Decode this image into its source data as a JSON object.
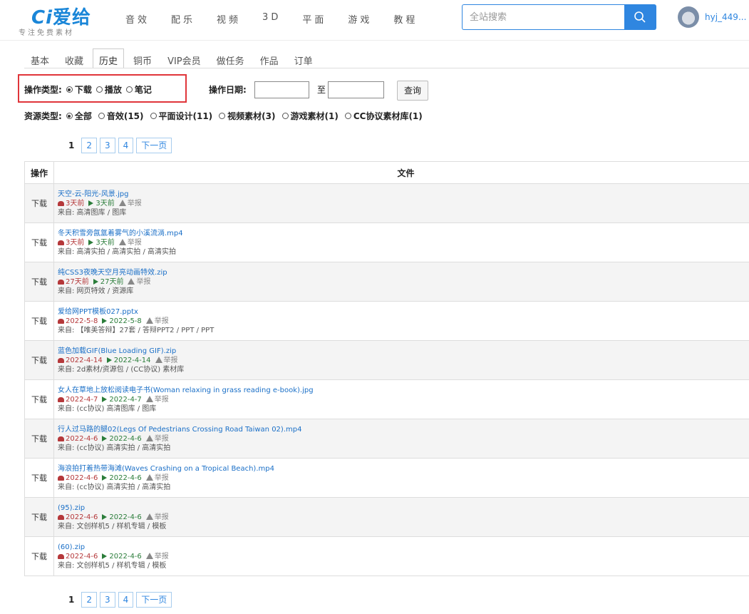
{
  "header": {
    "logo_text": "爱给",
    "logo_prefix": "Ci",
    "tagline": "专注免费素材",
    "nav": [
      "音效",
      "配乐",
      "视频",
      "3D",
      "平面",
      "游戏",
      "教程"
    ],
    "search_placeholder": "全站搜索",
    "username": "hyj_449..."
  },
  "tabs": [
    {
      "label": "基本",
      "active": false
    },
    {
      "label": "收藏",
      "active": false
    },
    {
      "label": "历史",
      "active": true
    },
    {
      "label": "铜币",
      "active": false
    },
    {
      "label": "VIP会员",
      "active": false
    },
    {
      "label": "做任务",
      "active": false
    },
    {
      "label": "作品",
      "active": false
    },
    {
      "label": "订单",
      "active": false
    }
  ],
  "filters": {
    "op_type_label": "操作类型:",
    "op_types": [
      {
        "label": "下载",
        "checked": true
      },
      {
        "label": "播放",
        "checked": false
      },
      {
        "label": "笔记",
        "checked": false
      }
    ],
    "date_label": "操作日期:",
    "date_to_label": "至",
    "query_button": "查询",
    "res_type_label": "资源类型:",
    "res_types": [
      {
        "label": "全部",
        "checked": true
      },
      {
        "label": "音效(15)",
        "checked": false
      },
      {
        "label": "平面设计(11)",
        "checked": false
      },
      {
        "label": "视频素材(3)",
        "checked": false
      },
      {
        "label": "游戏素材(1)",
        "checked": false
      },
      {
        "label": "CC协议素材库(1)",
        "checked": false
      }
    ]
  },
  "pagination": {
    "current": "1",
    "pages": [
      "2",
      "3",
      "4"
    ],
    "next": "下一页"
  },
  "table": {
    "headers": {
      "op": "操作",
      "file": "文件"
    },
    "action_label": "下载",
    "report_label": "举报",
    "rows": [
      {
        "name": "天空-云-阳光-风景.jpg",
        "dl": "3天前",
        "play": "3天前",
        "source": "来自: 高清图库 / 图库"
      },
      {
        "name": "冬天积雪旁氤氲着雾气的小溪流淌.mp4",
        "dl": "3天前",
        "play": "3天前",
        "source": "来自: 高清实拍 / 高清实拍 / 高清实拍"
      },
      {
        "name": "纯CSS3夜晚天空月亮动画特效.zip",
        "dl": "27天前",
        "play": "27天前",
        "source": "来自: 网页特效 / 资源库"
      },
      {
        "name": "爱给网PPT模板027.pptx",
        "dl": "2022-5-8",
        "play": "2022-5-8",
        "source": "来自: 【唯美答辩】27套 / 答辩PPT2 / PPT / PPT"
      },
      {
        "name": "蓝色加载GIF(Blue Loading GIF).zip",
        "dl": "2022-4-14",
        "play": "2022-4-14",
        "source": "来自: 2d素材/资源包 / (CC协议) 素材库"
      },
      {
        "name": "女人在草地上放松阅读电子书(Woman relaxing in grass reading e-book).jpg",
        "dl": "2022-4-7",
        "play": "2022-4-7",
        "source": "来自: (cc协议) 高清图库 / 图库"
      },
      {
        "name": "行人过马路的腿02(Legs Of Pedestrians Crossing Road Taiwan 02).mp4",
        "dl": "2022-4-6",
        "play": "2022-4-6",
        "source": "来自: (cc协议) 高清实拍 / 高清实拍"
      },
      {
        "name": "海浪拍打着热带海滩(Waves Crashing on a Tropical Beach).mp4",
        "dl": "2022-4-6",
        "play": "2022-4-6",
        "source": "来自: (cc协议) 高清实拍 / 高清实拍"
      },
      {
        "name": "(95).zip",
        "dl": "2022-4-6",
        "play": "2022-4-6",
        "source": "来自: 文创样机5 / 样机专辑 / 模板"
      },
      {
        "name": "(60).zip",
        "dl": "2022-4-6",
        "play": "2022-4-6",
        "source": "来自: 文创样机5 / 样机专辑 / 模板"
      }
    ]
  },
  "colors": {
    "accent": "#2f86e0",
    "highlight": "#e0353a",
    "download": "#b5383a",
    "play": "#2b7d3a"
  }
}
